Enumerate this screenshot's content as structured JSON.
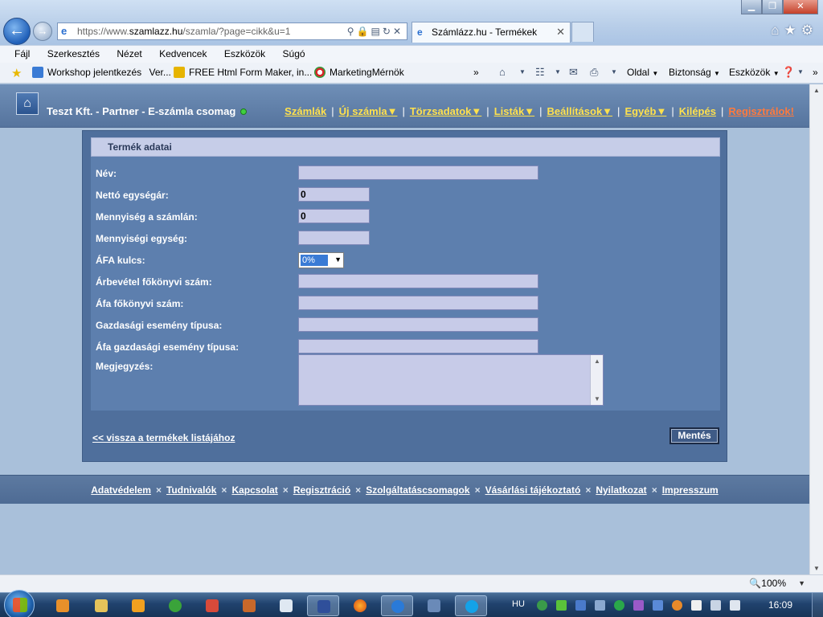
{
  "browser": {
    "address_prefix": "https://www.",
    "address_host": "szamlazz.hu",
    "address_path": "/szamla/?page=cikk&u=1",
    "tab_title": "Számlázz.hu - Termékek"
  },
  "menubar": [
    "Fájl",
    "Szerkesztés",
    "Nézet",
    "Kedvencek",
    "Eszközök",
    "Súgó"
  ],
  "favorites": {
    "item1": "Workshop jelentkezés",
    "item1b": "Ver...",
    "item2": "FREE Html Form Maker, in...",
    "item3": "MarketingMérnök",
    "more": "»"
  },
  "commandbar": {
    "page": "Oldal",
    "safety": "Biztonság",
    "tools": "Eszközök",
    "more": "»"
  },
  "site": {
    "title": "Teszt Kft. - Partner - E-számla csomag",
    "nav": {
      "invoices": "Számlák",
      "new_invoice": "Új számla▼",
      "master_data": "Törzsadatok▼",
      "lists": "Listák▼",
      "settings": "Beállítások▼",
      "other": "Egyéb▼",
      "logout": "Kilépés",
      "register": "Regisztrálok!"
    }
  },
  "form": {
    "heading": "Termék adatai",
    "labels": {
      "name": "Név:",
      "net_price": "Nettó egységár:",
      "quantity": "Mennyiség a számlán:",
      "unit": "Mennyiségi egység:",
      "vat": "ÁFA kulcs:",
      "revenue_ledger": "Árbevétel főkönyvi szám:",
      "vat_ledger": "Áfa főkönyvi szám:",
      "econ_event": "Gazdasági esemény típusa:",
      "vat_econ_event": "Áfa gazdasági esemény típusa:",
      "notes": "Megjegyzés:"
    },
    "values": {
      "name": "",
      "net_price": "0",
      "quantity": "0",
      "unit": "",
      "vat": "0%",
      "revenue_ledger": "",
      "vat_ledger": "",
      "econ_event": "",
      "vat_econ_event": "",
      "notes": ""
    },
    "back_link": "<< vissza a termékek listájához",
    "save_button": "Mentés"
  },
  "footer": [
    "Adatvédelem",
    "Tudnivalók",
    "Kapcsolat",
    "Regisztráció",
    "Szolgáltatáscsomagok",
    "Vásárlási tájékoztató",
    "Nyilatkozat",
    "Impresszum"
  ],
  "footer_separator": "×",
  "status": {
    "zoom": "100%"
  },
  "taskbar": {
    "language": "HU",
    "clock": "16:09"
  }
}
